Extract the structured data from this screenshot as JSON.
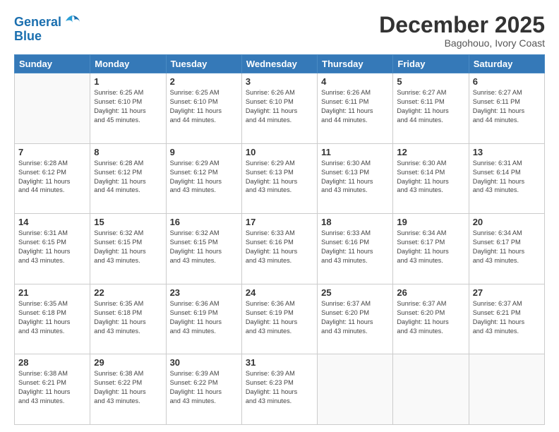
{
  "logo": {
    "line1": "General",
    "line2": "Blue"
  },
  "header": {
    "month": "December 2025",
    "location": "Bagohouo, Ivory Coast"
  },
  "weekdays": [
    "Sunday",
    "Monday",
    "Tuesday",
    "Wednesday",
    "Thursday",
    "Friday",
    "Saturday"
  ],
  "weeks": [
    [
      {
        "day": "",
        "info": ""
      },
      {
        "day": "1",
        "info": "Sunrise: 6:25 AM\nSunset: 6:10 PM\nDaylight: 11 hours\nand 45 minutes."
      },
      {
        "day": "2",
        "info": "Sunrise: 6:25 AM\nSunset: 6:10 PM\nDaylight: 11 hours\nand 44 minutes."
      },
      {
        "day": "3",
        "info": "Sunrise: 6:26 AM\nSunset: 6:10 PM\nDaylight: 11 hours\nand 44 minutes."
      },
      {
        "day": "4",
        "info": "Sunrise: 6:26 AM\nSunset: 6:11 PM\nDaylight: 11 hours\nand 44 minutes."
      },
      {
        "day": "5",
        "info": "Sunrise: 6:27 AM\nSunset: 6:11 PM\nDaylight: 11 hours\nand 44 minutes."
      },
      {
        "day": "6",
        "info": "Sunrise: 6:27 AM\nSunset: 6:11 PM\nDaylight: 11 hours\nand 44 minutes."
      }
    ],
    [
      {
        "day": "7",
        "info": "Sunrise: 6:28 AM\nSunset: 6:12 PM\nDaylight: 11 hours\nand 44 minutes."
      },
      {
        "day": "8",
        "info": "Sunrise: 6:28 AM\nSunset: 6:12 PM\nDaylight: 11 hours\nand 44 minutes."
      },
      {
        "day": "9",
        "info": "Sunrise: 6:29 AM\nSunset: 6:12 PM\nDaylight: 11 hours\nand 43 minutes."
      },
      {
        "day": "10",
        "info": "Sunrise: 6:29 AM\nSunset: 6:13 PM\nDaylight: 11 hours\nand 43 minutes."
      },
      {
        "day": "11",
        "info": "Sunrise: 6:30 AM\nSunset: 6:13 PM\nDaylight: 11 hours\nand 43 minutes."
      },
      {
        "day": "12",
        "info": "Sunrise: 6:30 AM\nSunset: 6:14 PM\nDaylight: 11 hours\nand 43 minutes."
      },
      {
        "day": "13",
        "info": "Sunrise: 6:31 AM\nSunset: 6:14 PM\nDaylight: 11 hours\nand 43 minutes."
      }
    ],
    [
      {
        "day": "14",
        "info": "Sunrise: 6:31 AM\nSunset: 6:15 PM\nDaylight: 11 hours\nand 43 minutes."
      },
      {
        "day": "15",
        "info": "Sunrise: 6:32 AM\nSunset: 6:15 PM\nDaylight: 11 hours\nand 43 minutes."
      },
      {
        "day": "16",
        "info": "Sunrise: 6:32 AM\nSunset: 6:15 PM\nDaylight: 11 hours\nand 43 minutes."
      },
      {
        "day": "17",
        "info": "Sunrise: 6:33 AM\nSunset: 6:16 PM\nDaylight: 11 hours\nand 43 minutes."
      },
      {
        "day": "18",
        "info": "Sunrise: 6:33 AM\nSunset: 6:16 PM\nDaylight: 11 hours\nand 43 minutes."
      },
      {
        "day": "19",
        "info": "Sunrise: 6:34 AM\nSunset: 6:17 PM\nDaylight: 11 hours\nand 43 minutes."
      },
      {
        "day": "20",
        "info": "Sunrise: 6:34 AM\nSunset: 6:17 PM\nDaylight: 11 hours\nand 43 minutes."
      }
    ],
    [
      {
        "day": "21",
        "info": "Sunrise: 6:35 AM\nSunset: 6:18 PM\nDaylight: 11 hours\nand 43 minutes."
      },
      {
        "day": "22",
        "info": "Sunrise: 6:35 AM\nSunset: 6:18 PM\nDaylight: 11 hours\nand 43 minutes."
      },
      {
        "day": "23",
        "info": "Sunrise: 6:36 AM\nSunset: 6:19 PM\nDaylight: 11 hours\nand 43 minutes."
      },
      {
        "day": "24",
        "info": "Sunrise: 6:36 AM\nSunset: 6:19 PM\nDaylight: 11 hours\nand 43 minutes."
      },
      {
        "day": "25",
        "info": "Sunrise: 6:37 AM\nSunset: 6:20 PM\nDaylight: 11 hours\nand 43 minutes."
      },
      {
        "day": "26",
        "info": "Sunrise: 6:37 AM\nSunset: 6:20 PM\nDaylight: 11 hours\nand 43 minutes."
      },
      {
        "day": "27",
        "info": "Sunrise: 6:37 AM\nSunset: 6:21 PM\nDaylight: 11 hours\nand 43 minutes."
      }
    ],
    [
      {
        "day": "28",
        "info": "Sunrise: 6:38 AM\nSunset: 6:21 PM\nDaylight: 11 hours\nand 43 minutes."
      },
      {
        "day": "29",
        "info": "Sunrise: 6:38 AM\nSunset: 6:22 PM\nDaylight: 11 hours\nand 43 minutes."
      },
      {
        "day": "30",
        "info": "Sunrise: 6:39 AM\nSunset: 6:22 PM\nDaylight: 11 hours\nand 43 minutes."
      },
      {
        "day": "31",
        "info": "Sunrise: 6:39 AM\nSunset: 6:23 PM\nDaylight: 11 hours\nand 43 minutes."
      },
      {
        "day": "",
        "info": ""
      },
      {
        "day": "",
        "info": ""
      },
      {
        "day": "",
        "info": ""
      }
    ]
  ]
}
